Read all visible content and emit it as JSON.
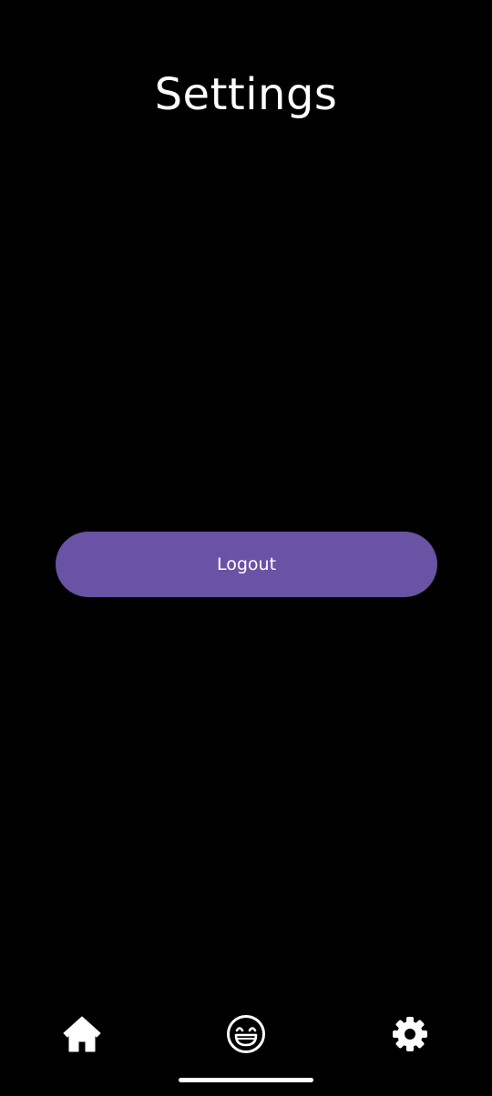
{
  "header": {
    "title": "Settings"
  },
  "main": {
    "logout_label": "Logout"
  },
  "bottom_nav": {
    "items": [
      {
        "icon": "home-icon"
      },
      {
        "icon": "laughing-face-icon"
      },
      {
        "icon": "gear-icon"
      }
    ]
  },
  "colors": {
    "background": "#000000",
    "accent": "#6a52a5",
    "text": "#ffffff"
  }
}
